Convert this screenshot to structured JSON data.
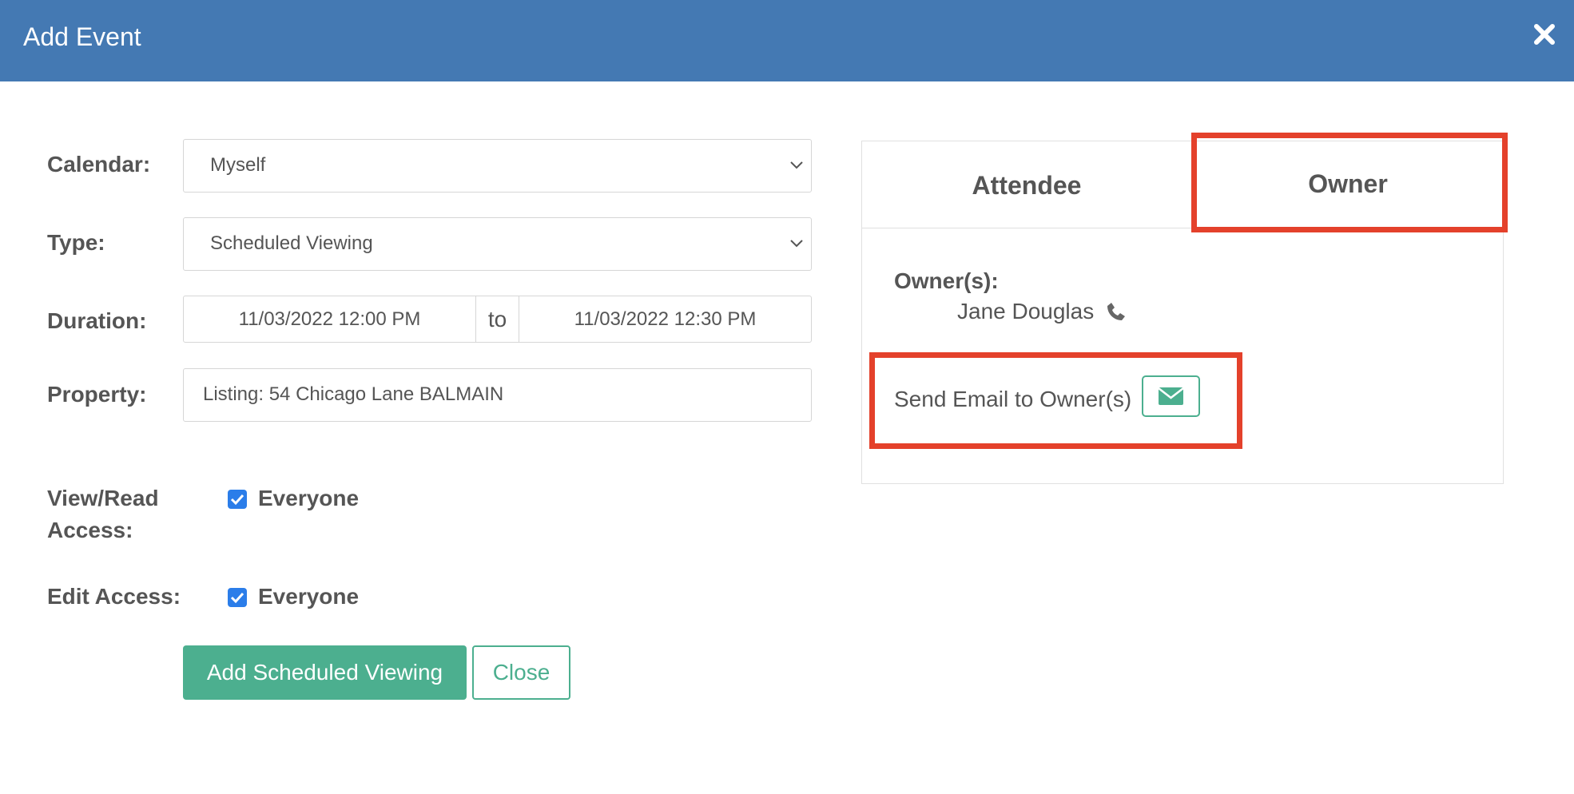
{
  "modal": {
    "title": "Add Event"
  },
  "form": {
    "calendar": {
      "label": "Calendar:",
      "value": "Myself"
    },
    "type": {
      "label": "Type:",
      "value": "Scheduled Viewing"
    },
    "duration": {
      "label": "Duration:",
      "start": "11/03/2022 12:00 PM",
      "separator": "to",
      "end": "11/03/2022 12:30 PM"
    },
    "property": {
      "label": "Property:",
      "value": "Listing: 54 Chicago Lane BALMAIN"
    },
    "view_access": {
      "label_line1": "View/Read",
      "label_line2": "Access:",
      "option": "Everyone",
      "checked": true
    },
    "edit_access": {
      "label": "Edit Access:",
      "option": "Everyone",
      "checked": true
    }
  },
  "buttons": {
    "submit": "Add Scheduled Viewing",
    "close": "Close"
  },
  "panel": {
    "tabs": [
      "Attendee",
      "Owner"
    ],
    "active_tab": "Owner",
    "owners_label": "Owner(s):",
    "owner_name": "Jane Douglas",
    "send_email_label": "Send Email to Owner(s)"
  },
  "icons": {
    "close": "close-icon",
    "phone": "phone-icon",
    "envelope": "envelope-icon",
    "chevron": "chevron-down-icon",
    "check": "checkmark-icon"
  },
  "colors": {
    "header": "#4479b3",
    "accent_green": "#4caf8f",
    "checkbox": "#2b7de9",
    "highlight": "#e4412b"
  }
}
